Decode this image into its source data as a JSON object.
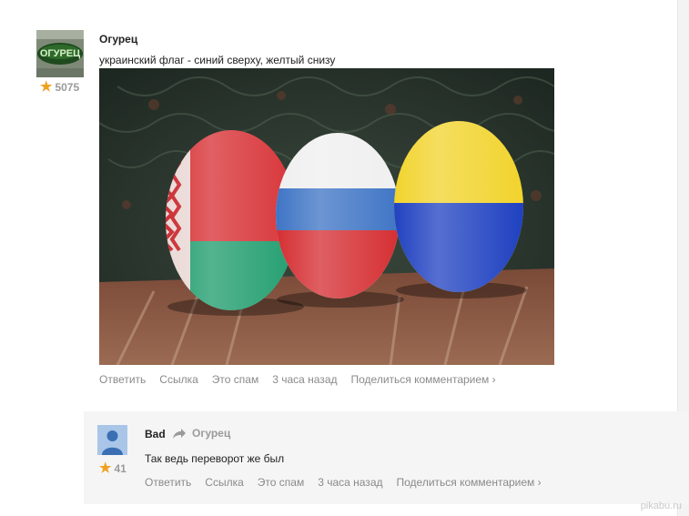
{
  "comment": {
    "author": "Огурец",
    "avatar_text": "ОГУРЕЦ",
    "rating": "5075",
    "text": "украинский флаг - синий сверху, желтый снизу",
    "actions": [
      "Ответить",
      "Ссылка",
      "Это спам",
      "3 часа назад",
      "Поделиться комментарием ›"
    ]
  },
  "reply": {
    "author": "Bad",
    "reply_to": "Огурец",
    "rating": "41",
    "text": "Так ведь переворот же был",
    "actions": [
      "Ответить",
      "Ссылка",
      "Это спам",
      "3 часа назад",
      "Поделиться комментарием ›"
    ]
  },
  "watermark": "pikabu.ru",
  "colors": {
    "star": "#f0a020",
    "meta_gray": "#8a8a8a",
    "reply_bg": "#f5f5f5"
  }
}
